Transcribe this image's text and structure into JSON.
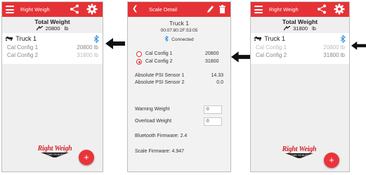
{
  "left_screen": {
    "app_title": "Right Weigh",
    "total_weight_label": "Total Weight",
    "total_weight_value": "20800",
    "total_weight_unit": "lb",
    "truck_name": "Truck 1",
    "configs": [
      {
        "label": "Cal Config 1",
        "value": "20800 lb"
      },
      {
        "label": "Cal Config 2",
        "value": "31800 lb"
      }
    ],
    "logo_main": "Right Weigh",
    "logo_sub": "LOAD SCALES",
    "fab_label": "+"
  },
  "middle_screen": {
    "title": "Scale Detail",
    "truck_name": "Truck 1",
    "mac_address": "00:07:80:2F:53:05",
    "connection_status": "Connected",
    "configs": [
      {
        "label": "Cal Config 1",
        "value": "20800",
        "selected": false
      },
      {
        "label": "Cal Config 2",
        "value": "31800",
        "selected": true
      }
    ],
    "sensors": [
      {
        "label": "Absolute PSI Sensor 1",
        "value": "14.33"
      },
      {
        "label": "Absolute PSI Sensor 2",
        "value": "0.0"
      }
    ],
    "warning_weight_label": "Warning Weight",
    "warning_weight_value": "0",
    "overload_weight_label": "Overload Weight",
    "overload_weight_value": "0",
    "bluetooth_firmware": "Bluetooth Firmware: 2.4",
    "scale_firmware": "Scale Firmware: 4.947"
  },
  "right_screen": {
    "app_title": "Right Weigh",
    "total_weight_label": "Total Weight",
    "total_weight_value": "31800",
    "total_weight_unit": "lb",
    "truck_name": "Truck 1",
    "configs": [
      {
        "label": "Cal Config 1",
        "value": "20800 lb"
      },
      {
        "label": "Cal Config 2",
        "value": "31800 lb"
      }
    ],
    "logo_main": "Right Weigh",
    "logo_sub": "LOAD SCALES",
    "fab_label": "+"
  },
  "colors": {
    "appbar_red": "#e53236",
    "bluetooth_blue": "#2f8fe0",
    "fab_red": "#e9343a"
  },
  "icons": [
    "hamburger-menu-icon",
    "share-icon",
    "gear-icon",
    "back-chevron-icon",
    "pencil-icon",
    "trash-icon",
    "truck-icon",
    "bluetooth-icon",
    "scale-icon",
    "plus-icon",
    "arrow-left-icon"
  ]
}
